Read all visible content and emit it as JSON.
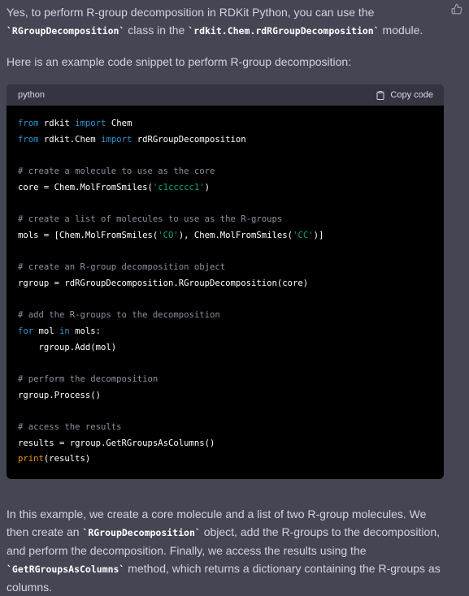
{
  "intro": {
    "part1": "Yes, to perform R-group decomposition in RDKit Python, you can use the",
    "class_name": "`RGroupDecomposition`",
    "part2": " class in the ",
    "module_name": "`rdkit.Chem.rdRGroupDecomposition`",
    "part3": " module."
  },
  "lead": "Here is an example code snippet to perform R-group decomposition:",
  "code_block": {
    "language": "python",
    "copy_label": "Copy code",
    "lines": [
      [
        {
          "t": "from",
          "c": "kw"
        },
        {
          "t": " rdkit ",
          "c": ""
        },
        {
          "t": "import",
          "c": "kw"
        },
        {
          "t": " Chem",
          "c": ""
        }
      ],
      [
        {
          "t": "from",
          "c": "kw"
        },
        {
          "t": " rdkit.Chem ",
          "c": ""
        },
        {
          "t": "import",
          "c": "kw"
        },
        {
          "t": " rdRGroupDecomposition",
          "c": ""
        }
      ],
      [],
      [
        {
          "t": "# create a molecule to use as the core",
          "c": "cm"
        }
      ],
      [
        {
          "t": "core = Chem.MolFromSmiles(",
          "c": ""
        },
        {
          "t": "'c1ccccc1'",
          "c": "st"
        },
        {
          "t": ")",
          "c": ""
        }
      ],
      [],
      [
        {
          "t": "# create a list of molecules to use as the R-groups",
          "c": "cm"
        }
      ],
      [
        {
          "t": "mols = [Chem.MolFromSmiles(",
          "c": ""
        },
        {
          "t": "'CO'",
          "c": "st"
        },
        {
          "t": "), Chem.MolFromSmiles(",
          "c": ""
        },
        {
          "t": "'CC'",
          "c": "st"
        },
        {
          "t": ")]",
          "c": ""
        }
      ],
      [],
      [
        {
          "t": "# create an R-group decomposition object",
          "c": "cm"
        }
      ],
      [
        {
          "t": "rgroup = rdRGroupDecomposition.RGroupDecomposition(core)",
          "c": ""
        }
      ],
      [],
      [
        {
          "t": "# add the R-groups to the decomposition",
          "c": "cm"
        }
      ],
      [
        {
          "t": "for",
          "c": "kw"
        },
        {
          "t": " mol ",
          "c": ""
        },
        {
          "t": "in",
          "c": "kw"
        },
        {
          "t": " mols:",
          "c": ""
        }
      ],
      [
        {
          "t": "    rgroup.Add(mol)",
          "c": ""
        }
      ],
      [],
      [
        {
          "t": "# perform the decomposition",
          "c": "cm"
        }
      ],
      [
        {
          "t": "rgroup.Process()",
          "c": ""
        }
      ],
      [],
      [
        {
          "t": "# access the results",
          "c": "cm"
        }
      ],
      [
        {
          "t": "results = rgroup.GetRGroupsAsColumns()",
          "c": ""
        }
      ],
      [
        {
          "t": "print",
          "c": "bi"
        },
        {
          "t": "(results)",
          "c": ""
        }
      ]
    ]
  },
  "outro": {
    "part1": "In this example, we create a core molecule and a list of two R-group molecules. We then create an ",
    "obj_name": "`RGroupDecomposition`",
    "part2": " object, add the R-groups to the decomposition, and perform the decomposition. Finally, we access the results using the ",
    "method_name": "`GetRGroupsAsColumns`",
    "part3": " method, which returns a dictionary containing the R-groups as columns."
  },
  "icons": {
    "thumbs_up": "thumbs-up-icon",
    "copy": "clipboard-icon"
  }
}
